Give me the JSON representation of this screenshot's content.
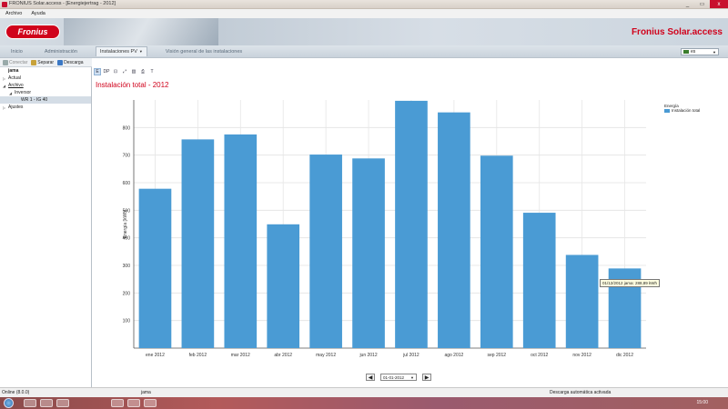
{
  "window": {
    "title": "FRONIUS Solar.access - [Energiejertrag - 2012]",
    "controls": [
      "_",
      "▭",
      "x"
    ]
  },
  "menu": {
    "items": [
      "Archivo",
      "Ayuda"
    ]
  },
  "banner": {
    "logo_text": "Fronius",
    "brand": "Fronius Solar.access"
  },
  "nav": {
    "tabs": [
      "Inicio",
      "Administración",
      "Instalaciones PV",
      "Visión general de las instalaciones"
    ],
    "active_index": 2,
    "language": "es"
  },
  "left_toolbar": {
    "connect": "Conectar",
    "separate": "Separar",
    "download": "Descarga"
  },
  "tree": {
    "root": "jama",
    "items": [
      {
        "label": "Actual",
        "indent": 0,
        "twisty": "▷"
      },
      {
        "label": "Archivo",
        "indent": 0,
        "twisty": "◢",
        "underline": true
      },
      {
        "label": "Inversor",
        "indent": 1,
        "twisty": "◢"
      },
      {
        "label": "WR 1 - IG 40",
        "indent": 2,
        "twisty": "",
        "selected": true
      },
      {
        "label": "Ajustes",
        "indent": 0,
        "twisty": "▷"
      }
    ]
  },
  "chart_tools": [
    "E",
    "DP",
    "⊡",
    "⤢",
    "▥",
    "⎙",
    "T"
  ],
  "chart_title": "Instalación total - 2012",
  "legend": {
    "title": "Energía",
    "entry": "Instalación total",
    "color": "#4a9bd4"
  },
  "tooltip": "01/12/2012 jama: 288,89 kWh",
  "date_nav": {
    "prev": "◀",
    "next": "▶",
    "value": "01-01-2012"
  },
  "status": {
    "left": "Online (8.0.0)",
    "middle": "jama",
    "right": "Descarga automática activada"
  },
  "taskbar": {
    "clock": "15:00"
  },
  "chart_data": {
    "type": "bar",
    "categories": [
      "ene 2012",
      "feb 2012",
      "mar 2012",
      "abr 2012",
      "may 2012",
      "jun 2012",
      "jul 2012",
      "ago 2012",
      "sep 2012",
      "oct 2012",
      "nov 2012",
      "dic 2012"
    ],
    "values": [
      578,
      757,
      775,
      449,
      702,
      688,
      897,
      855,
      698,
      491,
      338,
      288.89
    ],
    "ylabel": "Energía [kWh]",
    "xlabel": "",
    "ylim": [
      0,
      900
    ],
    "yticks": [
      100,
      200,
      300,
      400,
      500,
      600,
      700,
      800
    ],
    "grid": true,
    "legend_position": "top-right",
    "bar_color": "#4a9bd4"
  }
}
